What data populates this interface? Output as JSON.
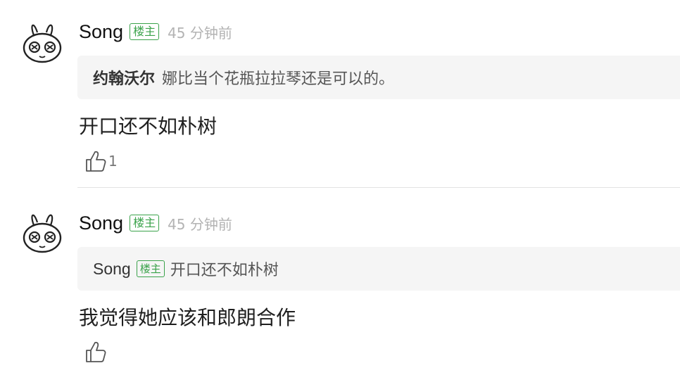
{
  "comments": [
    {
      "username": "Song",
      "badge": "楼主",
      "timestamp": "45 分钟前",
      "quote": {
        "author": "约翰沃尔",
        "text": "娜比当个花瓶拉拉琴还是可以的。"
      },
      "text": "开口还不如朴树",
      "likes": "1"
    },
    {
      "username": "Song",
      "badge": "楼主",
      "timestamp": "45 分钟前",
      "quote": {
        "author": "Song",
        "badge": "楼主",
        "text": "开口还不如朴树"
      },
      "text": "我觉得她应该和郎朗合作",
      "likes": ""
    }
  ],
  "icons": {
    "avatar": "cartoon-bunny-avatar",
    "like": "thumbs-up-icon"
  },
  "colors": {
    "badge": "#3aa24a",
    "quote_bg": "#f5f5f5",
    "timestamp": "#b3b3b3"
  }
}
